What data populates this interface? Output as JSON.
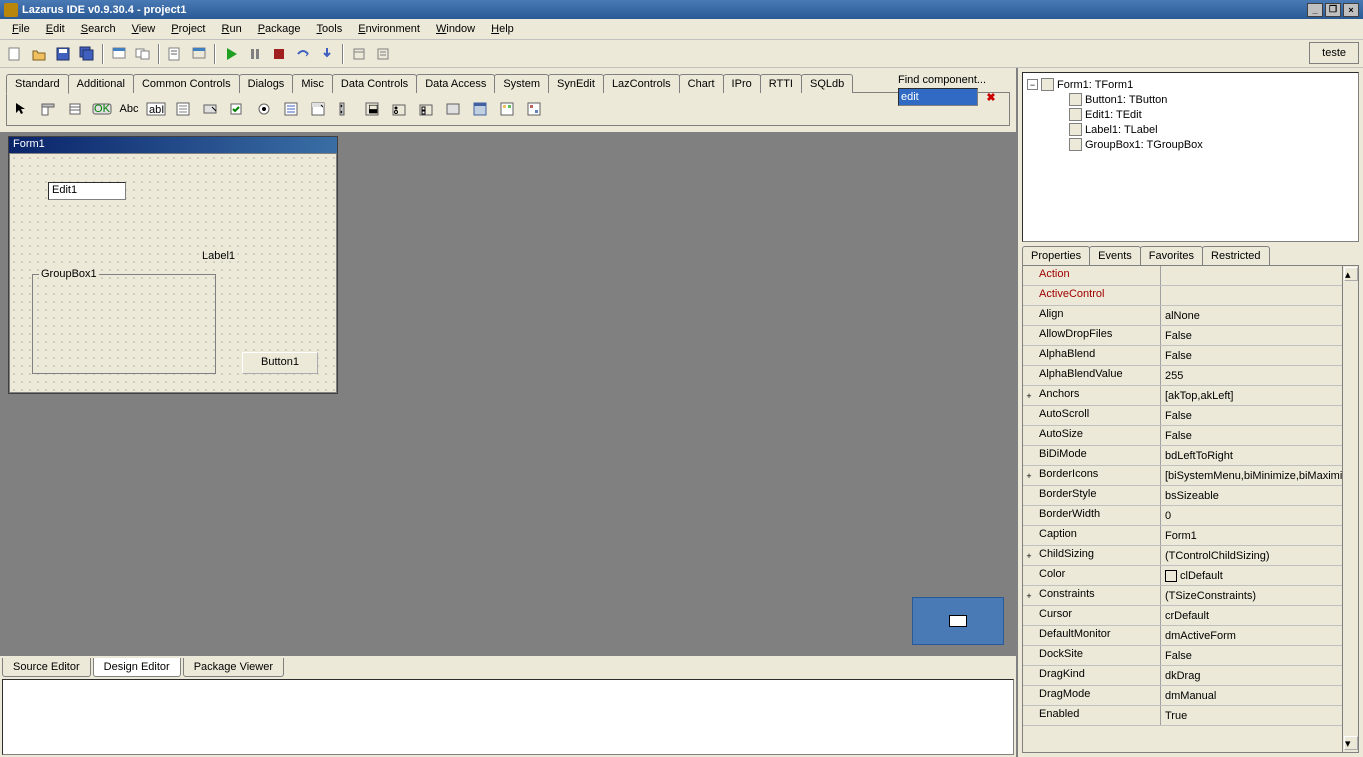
{
  "title": "Lazarus IDE v0.9.30.4 - project1",
  "menus": [
    "File",
    "Edit",
    "Search",
    "View",
    "Project",
    "Run",
    "Package",
    "Tools",
    "Environment",
    "Window",
    "Help"
  ],
  "teste": "teste",
  "palette_tabs": [
    "Standard",
    "Additional",
    "Common Controls",
    "Dialogs",
    "Misc",
    "Data Controls",
    "Data Access",
    "System",
    "SynEdit",
    "LazControls",
    "Chart",
    "IPro",
    "RTTI",
    "SQLdb"
  ],
  "find_component_label": "Find component...",
  "find_value": "edit",
  "form": {
    "title": "Form1",
    "edit": "Edit1",
    "label": "Label1",
    "groupbox": "GroupBox1",
    "button": "Button1"
  },
  "bottom_tabs": [
    "Source Editor",
    "Design Editor",
    "Package Viewer"
  ],
  "tree": {
    "root": "Form1: TForm1",
    "children": [
      "Button1: TButton",
      "Edit1: TEdit",
      "Label1: TLabel",
      "GroupBox1: TGroupBox"
    ]
  },
  "prop_tabs": [
    "Properties",
    "Events",
    "Favorites",
    "Restricted"
  ],
  "properties": [
    {
      "n": "Action",
      "v": "",
      "red": true,
      "exp": ""
    },
    {
      "n": "ActiveControl",
      "v": "",
      "red": true,
      "exp": ""
    },
    {
      "n": "Align",
      "v": "alNone",
      "exp": ""
    },
    {
      "n": "AllowDropFiles",
      "v": "False",
      "exp": ""
    },
    {
      "n": "AlphaBlend",
      "v": "False",
      "exp": ""
    },
    {
      "n": "AlphaBlendValue",
      "v": "255",
      "exp": ""
    },
    {
      "n": "Anchors",
      "v": "[akTop,akLeft]",
      "exp": "+"
    },
    {
      "n": "AutoScroll",
      "v": "False",
      "exp": ""
    },
    {
      "n": "AutoSize",
      "v": "False",
      "exp": ""
    },
    {
      "n": "BiDiMode",
      "v": "bdLeftToRight",
      "exp": ""
    },
    {
      "n": "BorderIcons",
      "v": "[biSystemMenu,biMinimize,biMaximize]",
      "exp": "+"
    },
    {
      "n": "BorderStyle",
      "v": "bsSizeable",
      "exp": ""
    },
    {
      "n": "BorderWidth",
      "v": "0",
      "exp": ""
    },
    {
      "n": "Caption",
      "v": "Form1",
      "exp": ""
    },
    {
      "n": "ChildSizing",
      "v": "(TControlChildSizing)",
      "exp": "+"
    },
    {
      "n": "Color",
      "v": "clDefault",
      "exp": "",
      "color": true
    },
    {
      "n": "Constraints",
      "v": "(TSizeConstraints)",
      "exp": "+"
    },
    {
      "n": "Cursor",
      "v": "crDefault",
      "exp": ""
    },
    {
      "n": "DefaultMonitor",
      "v": "dmActiveForm",
      "exp": ""
    },
    {
      "n": "DockSite",
      "v": "False",
      "exp": ""
    },
    {
      "n": "DragKind",
      "v": "dkDrag",
      "exp": ""
    },
    {
      "n": "DragMode",
      "v": "dmManual",
      "exp": ""
    },
    {
      "n": "Enabled",
      "v": "True",
      "exp": ""
    }
  ],
  "palette_icons": [
    "arrow",
    "menu",
    "popup",
    "ok",
    "Abc",
    "abI",
    "edit",
    "memo",
    "toggle",
    "check",
    "radio",
    "list",
    "combo",
    "scroll",
    "group",
    "radio2",
    "panel",
    "frame",
    "action",
    "action2"
  ]
}
